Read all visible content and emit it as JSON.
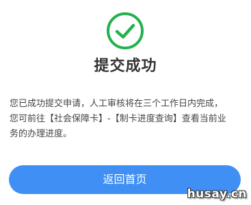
{
  "result": {
    "icon": "check-circle-icon",
    "icon_color": "#22b14c",
    "title": "提交成功",
    "message_lines": [
      "您已成功提交申请，人工审核将在三个工作日内完成，",
      "您可前往【社会保障卡】-【制卡进度查询】查看当前业",
      "务的办理进度。"
    ]
  },
  "actions": {
    "return_home_label": "返回首页",
    "button_color": "#3f8ff4"
  },
  "watermark": {
    "text": "husay.cn"
  }
}
